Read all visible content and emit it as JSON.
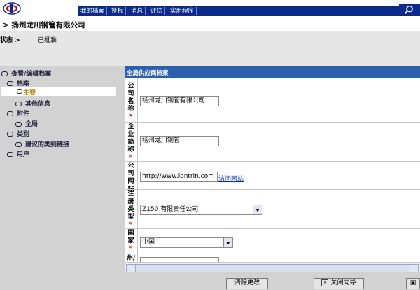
{
  "nav": {
    "items": [
      "我的档案",
      "投标",
      "消息",
      "评估",
      "实用程序"
    ]
  },
  "header": {
    "company_title": "> 扬州龙川钢管有限公司"
  },
  "status": {
    "label": "状态 >",
    "value": "已批准"
  },
  "sidebar": {
    "items": [
      {
        "label": "查看/编辑档案",
        "level": 0
      },
      {
        "label": "档案",
        "level": 1
      },
      {
        "label": "主要",
        "level": 2,
        "selected": true
      },
      {
        "label": "其他信息",
        "level": 2
      },
      {
        "label": "附件",
        "level": 1
      },
      {
        "label": "全局",
        "level": 2
      },
      {
        "label": "类别",
        "level": 1
      },
      {
        "label": "建议的类别链接",
        "level": 2
      },
      {
        "label": "用户",
        "level": 1
      }
    ]
  },
  "panel": {
    "title": "全局供应商档案"
  },
  "form": {
    "company_name": {
      "label": [
        "公",
        "司",
        "名",
        "称"
      ],
      "value": "扬州龙川钢管有限公司"
    },
    "short_name": {
      "label": [
        "企",
        "业",
        "简",
        "称"
      ],
      "value": "扬州龙川钢管"
    },
    "website": {
      "label": [
        "公",
        "司",
        "网",
        "站"
      ],
      "value": "http://www.lontrin.com",
      "link": "访问网站"
    },
    "reg_type": {
      "label": [
        "注",
        "册",
        "类",
        "型"
      ],
      "value": "Z150 有限责任公司"
    },
    "country": {
      "label": [
        "国",
        "家"
      ],
      "value": "中国"
    },
    "state": {
      "label": [
        "州/"
      ]
    },
    "required_mark": "*"
  },
  "buttons": {
    "clear": "清除更改",
    "close": "关闭向导"
  },
  "colors": {
    "nav_bg": "#0b2b8c",
    "panel_header": "#2c5fae",
    "sidebar_bg": "#d2d2d2",
    "required": "#d00000"
  }
}
